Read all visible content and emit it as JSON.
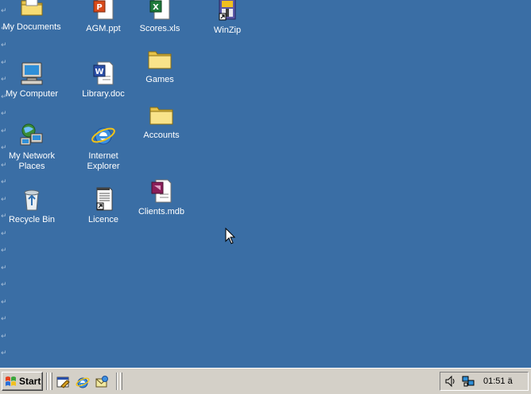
{
  "desktop": {
    "background": "#3a6ea5",
    "icons": [
      {
        "label": "My Documents",
        "icon": "my-documents-folder-icon"
      },
      {
        "label": "AGM.ppt",
        "icon": "powerpoint-file-icon"
      },
      {
        "label": "Scores.xls",
        "icon": "excel-file-icon"
      },
      {
        "label": "WinZip",
        "icon": "winzip-icon"
      },
      {
        "label": "My Computer",
        "icon": "my-computer-icon"
      },
      {
        "label": "Library.doc",
        "icon": "word-file-icon"
      },
      {
        "label": "Games",
        "icon": "folder-icon"
      },
      {
        "label": "My Network\nPlaces",
        "icon": "network-places-icon"
      },
      {
        "label": "Internet\nExplorer",
        "icon": "internet-explorer-icon"
      },
      {
        "label": "Accounts",
        "icon": "folder-icon"
      },
      {
        "label": "Recycle Bin",
        "icon": "recycle-bin-icon"
      },
      {
        "label": "Licence",
        "icon": "text-file-shortcut-icon"
      },
      {
        "label": "Clients.mdb",
        "icon": "access-file-icon"
      }
    ]
  },
  "taskbar": {
    "start_label": "Start",
    "quick_launch": [
      "show-desktop-icon",
      "internet-explorer-icon",
      "outlook-express-icon"
    ],
    "tray": {
      "icons": [
        "volume-icon",
        "network-icon"
      ],
      "clock": "01:51 ä"
    }
  }
}
